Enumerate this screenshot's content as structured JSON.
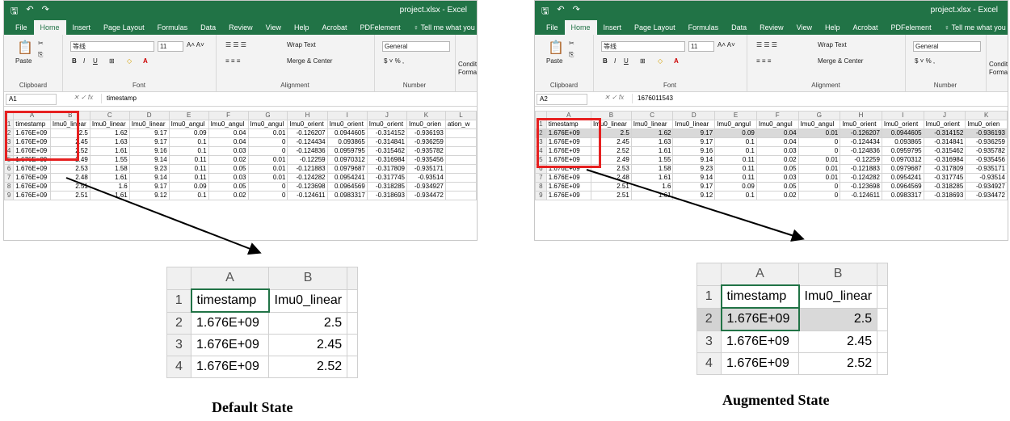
{
  "window_title": "project.xlsx  -  Excel",
  "menu_tabs": [
    "File",
    "Home",
    "Insert",
    "Page Layout",
    "Formulas",
    "Data",
    "Review",
    "View",
    "Help",
    "Acrobat",
    "PDFelement"
  ],
  "tell_me": "Tell me what you want to do",
  "ribbon": {
    "paste": "Paste",
    "clipboard": "Clipboard",
    "font_name": "等线",
    "font_size": "11",
    "font": "Font",
    "wrap_text": "Wrap Text",
    "merge_center": "Merge & Center",
    "alignment": "Alignment",
    "number_format": "General",
    "number": "Number",
    "conditional": "Conditional",
    "formatting": "Formatting"
  },
  "columns": [
    "A",
    "B",
    "C",
    "D",
    "E",
    "F",
    "G",
    "H",
    "I",
    "J",
    "K",
    "L"
  ],
  "headers": [
    "timestamp",
    "Imu0_linear",
    "Imu0_linear",
    "Imu0_linear",
    "Imu0_angul",
    "Imu0_angul",
    "Imu0_angul",
    "Imu0_orient",
    "Imu0_orient",
    "Imu0_orient",
    "Imu0_orien",
    "ation_w"
  ],
  "rows": [
    [
      "1.676E+09",
      "2.5",
      "1.62",
      "9.17",
      "0.09",
      "0.04",
      "0.01",
      "-0.126207",
      "0.0944605",
      "-0.314152",
      "-0.936193"
    ],
    [
      "1.676E+09",
      "2.45",
      "1.63",
      "9.17",
      "0.1",
      "0.04",
      "0",
      "-0.124434",
      "0.093865",
      "-0.314841",
      "-0.936259"
    ],
    [
      "1.676E+09",
      "2.52",
      "1.61",
      "9.16",
      "0.1",
      "0.03",
      "0",
      "-0.124836",
      "0.0959795",
      "-0.315462",
      "-0.935782"
    ],
    [
      "1.676E+09",
      "2.49",
      "1.55",
      "9.14",
      "0.11",
      "0.02",
      "0.01",
      "-0.12259",
      "0.0970312",
      "-0.316984",
      "-0.935456"
    ],
    [
      "1.676E+09",
      "2.53",
      "1.58",
      "9.23",
      "0.11",
      "0.05",
      "0.01",
      "-0.121883",
      "0.0979687",
      "-0.317809",
      "-0.935171"
    ],
    [
      "1.676E+09",
      "2.48",
      "1.61",
      "9.14",
      "0.11",
      "0.03",
      "0.01",
      "-0.124282",
      "0.0954241",
      "-0.317745",
      "-0.93514"
    ],
    [
      "1.676E+09",
      "2.51",
      "1.6",
      "9.17",
      "0.09",
      "0.05",
      "0",
      "-0.123698",
      "0.0964569",
      "-0.318285",
      "-0.934927"
    ],
    [
      "1.676E+09",
      "2.51",
      "1.61",
      "9.12",
      "0.1",
      "0.02",
      "0",
      "-0.124611",
      "0.0983317",
      "-0.318693",
      "-0.934472"
    ]
  ],
  "left": {
    "name_box": "A1",
    "formula": "timestamp",
    "caption": "Default State"
  },
  "right": {
    "name_box": "A2",
    "formula": "1676011543",
    "caption": "Augmented State"
  },
  "zoom": {
    "cols": [
      "A",
      "B"
    ],
    "row_nums": [
      "1",
      "2",
      "3",
      "4"
    ],
    "cells": [
      [
        "timestamp",
        "Imu0_linear"
      ],
      [
        "1.676E+09",
        "2.5"
      ],
      [
        "1.676E+09",
        "2.45"
      ],
      [
        "1.676E+09",
        "2.52"
      ]
    ]
  }
}
